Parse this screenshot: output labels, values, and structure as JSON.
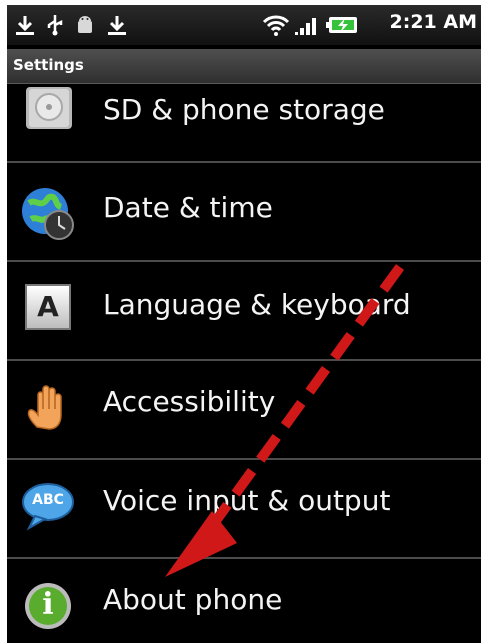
{
  "status_bar": {
    "icons": [
      "download-icon",
      "usb-icon",
      "android-debug-icon",
      "download-icon",
      "wifi-icon",
      "signal-icon",
      "battery-charging-icon"
    ],
    "time": "2:21 AM"
  },
  "title_bar": {
    "title": "Settings"
  },
  "settings_list": [
    {
      "label": "SD & phone storage",
      "icon": "sd-card-icon"
    },
    {
      "label": "Date & time",
      "icon": "globe-clock-icon"
    },
    {
      "label": "Language & keyboard",
      "icon": "keyboard-a-icon"
    },
    {
      "label": "Accessibility",
      "icon": "hand-icon"
    },
    {
      "label": "Voice input & output",
      "icon": "speech-bubble-abc-icon"
    },
    {
      "label": "About phone",
      "icon": "info-icon"
    }
  ],
  "icon_text": {
    "keyboard": "A",
    "speech": "ABC",
    "info": "i"
  },
  "annotation": {
    "type": "dashed-arrow",
    "color": "#d01818",
    "points_to": "About phone"
  }
}
